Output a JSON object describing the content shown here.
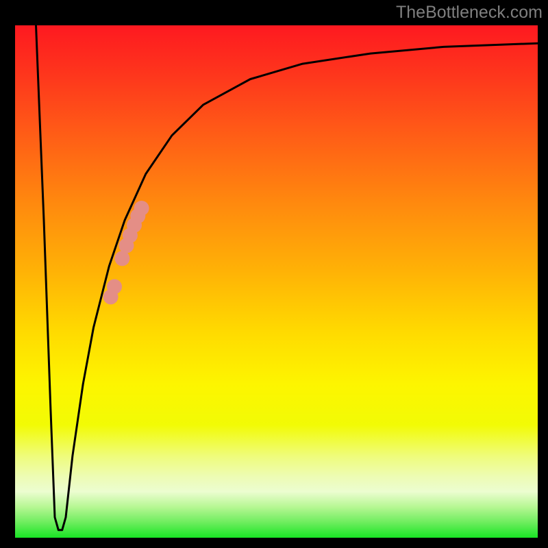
{
  "attribution": "TheBottleneck.com",
  "colors": {
    "frame": "#000000",
    "curve_stroke": "#000000",
    "marker_fill": "#e48e86",
    "attribution_text": "#7f7f7f"
  },
  "chart_data": {
    "type": "line",
    "title": "",
    "xlabel": "",
    "ylabel": "",
    "xlim": [
      0,
      100
    ],
    "ylim": [
      0,
      100
    ],
    "grid": false,
    "curve": [
      {
        "x": 4.0,
        "y": 100.0
      },
      {
        "x": 5.5,
        "y": 62.0
      },
      {
        "x": 6.8,
        "y": 25.0
      },
      {
        "x": 7.6,
        "y": 4.0
      },
      {
        "x": 8.3,
        "y": 1.5
      },
      {
        "x": 9.0,
        "y": 1.5
      },
      {
        "x": 9.7,
        "y": 4.0
      },
      {
        "x": 11.0,
        "y": 16.0
      },
      {
        "x": 13.0,
        "y": 30.0
      },
      {
        "x": 15.0,
        "y": 41.0
      },
      {
        "x": 18.0,
        "y": 53.0
      },
      {
        "x": 21.0,
        "y": 62.0
      },
      {
        "x": 25.0,
        "y": 71.0
      },
      {
        "x": 30.0,
        "y": 78.5
      },
      {
        "x": 36.0,
        "y": 84.5
      },
      {
        "x": 45.0,
        "y": 89.5
      },
      {
        "x": 55.0,
        "y": 92.5
      },
      {
        "x": 68.0,
        "y": 94.5
      },
      {
        "x": 82.0,
        "y": 95.8
      },
      {
        "x": 100.0,
        "y": 96.5
      }
    ],
    "markers": [
      {
        "x": 18.3,
        "y": 47.0
      },
      {
        "x": 19.0,
        "y": 49.0
      },
      {
        "x": 20.5,
        "y": 54.5
      },
      {
        "x": 21.3,
        "y": 57.0
      },
      {
        "x": 22.0,
        "y": 59.0
      },
      {
        "x": 22.8,
        "y": 61.0
      },
      {
        "x": 23.5,
        "y": 62.8
      },
      {
        "x": 24.2,
        "y": 64.3
      }
    ]
  }
}
